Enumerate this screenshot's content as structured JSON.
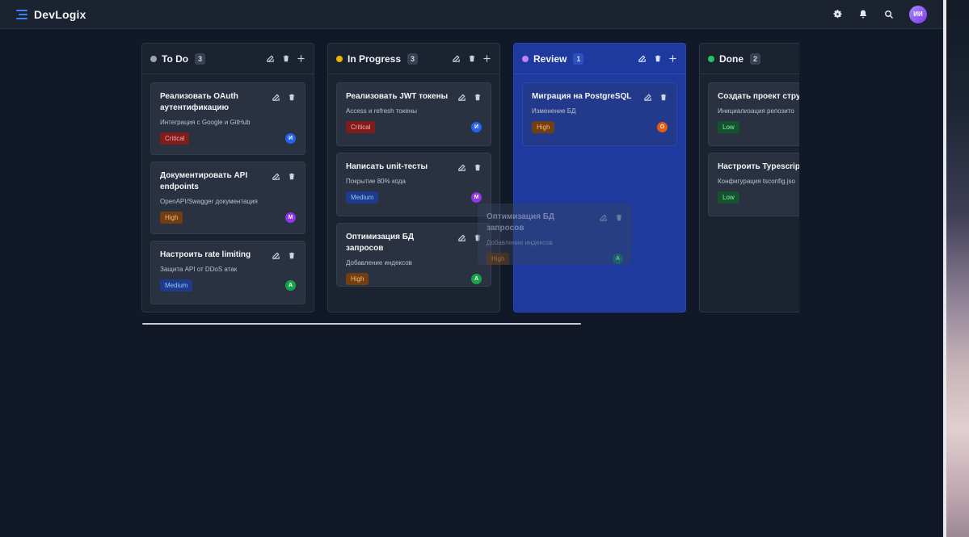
{
  "app": {
    "title": "DevLogix",
    "user_initials": "ИИ"
  },
  "icons": {
    "menu": "list-icon",
    "settings": "gear-icon",
    "notifications": "bell-icon",
    "search": "search-icon",
    "edit": "edit-icon",
    "delete": "trash-icon",
    "add": "plus-icon"
  },
  "colors": {
    "accent": "#3b82f6",
    "review_column": "#1e3a9f"
  },
  "columns": [
    {
      "title": "To Do",
      "count": "3",
      "dot": "#9ca3af",
      "cards": [
        {
          "title": "Реализовать OAuth аутентификацию",
          "desc": "Интеграция с Google и GitHub",
          "priority": "Critical",
          "avatar": "И",
          "avatar_color": "#2563eb"
        },
        {
          "title": "Документировать API endpoints",
          "desc": "OpenAPI/Swagger документация",
          "priority": "High",
          "avatar": "М",
          "avatar_color": "#9333ea"
        },
        {
          "title": "Настроить rate limiting",
          "desc": "Защита API от DDoS атак",
          "priority": "Medium",
          "avatar": "А",
          "avatar_color": "#16a34a"
        }
      ]
    },
    {
      "title": "In Progress",
      "count": "3",
      "dot": "#eab308",
      "cards": [
        {
          "title": "Реализовать JWT токены",
          "desc": "Access и refresh токены",
          "priority": "Critical",
          "avatar": "И",
          "avatar_color": "#2563eb"
        },
        {
          "title": "Написать unit-тесты",
          "desc": "Покрытие 80% кода",
          "priority": "Medium",
          "avatar": "М",
          "avatar_color": "#9333ea"
        },
        {
          "title": "Оптимизация БД запросов",
          "desc": "Добавление индексов",
          "priority": "High",
          "avatar": "А",
          "avatar_color": "#16a34a"
        }
      ]
    },
    {
      "title": "Review",
      "count": "1",
      "dot": "#c084fc",
      "cards": [
        {
          "title": "Миграция на PostgreSQL",
          "desc": "Изменение БД",
          "priority": "High",
          "avatar": "О",
          "avatar_color": "#ea580c"
        }
      ]
    },
    {
      "title": "Done",
      "count": "2",
      "dot": "#22c55e",
      "cards": [
        {
          "title": "Создать проект струк",
          "desc": "Инициализация репозито",
          "priority": "Low"
        },
        {
          "title": "Настроить Typescript",
          "desc": "Конфигурация tsconfig.jso",
          "priority": "Low"
        }
      ]
    }
  ],
  "drag_ghost": {
    "title": "Оптимизация БД запросов",
    "desc": "Добавление индексов",
    "priority": "High",
    "avatar": "А"
  }
}
